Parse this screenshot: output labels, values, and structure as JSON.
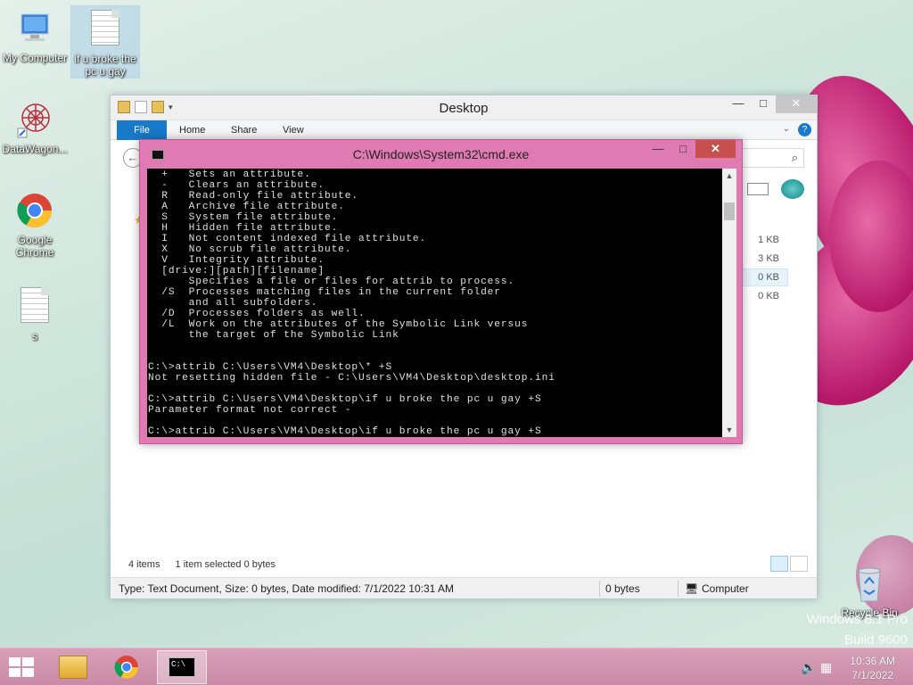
{
  "desktop": {
    "icons": [
      {
        "label": "My Computer"
      },
      {
        "label": "if u broke the pc u gay"
      },
      {
        "label": "DataWagon..."
      },
      {
        "label": "Google Chrome"
      },
      {
        "label": "s"
      },
      {
        "label": "Recycle Bin"
      }
    ],
    "watermark": {
      "line1": "Windows 8.1 Pro",
      "line2": "Build 9600"
    }
  },
  "explorer": {
    "title": "Desktop",
    "ribbon_tabs": {
      "file": "File",
      "home": "Home",
      "share": "Share",
      "view": "View"
    },
    "sizes": [
      "1 KB",
      "3 KB",
      "0 KB",
      "0 KB"
    ],
    "status": {
      "items": "4 items",
      "selected": "1 item selected  0 bytes"
    },
    "details": {
      "info": "Type: Text Document, Size: 0 bytes, Date modified: 7/1/2022 10:31 AM",
      "size": "0 bytes",
      "location": "Computer"
    }
  },
  "cmd": {
    "title": "C:\\Windows\\System32\\cmd.exe",
    "output": "  +   Sets an attribute.\n  -   Clears an attribute.\n  R   Read-only file attribute.\n  A   Archive file attribute.\n  S   System file attribute.\n  H   Hidden file attribute.\n  I   Not content indexed file attribute.\n  X   No scrub file attribute.\n  V   Integrity attribute.\n  [drive:][path][filename]\n      Specifies a file or files for attrib to process.\n  /S  Processes matching files in the current folder\n      and all subfolders.\n  /D  Processes folders as well.\n  /L  Work on the attributes of the Symbolic Link versus\n      the target of the Symbolic Link\n\n\nC:\\>attrib C:\\Users\\VM4\\Desktop\\* +S\nNot resetting hidden file - C:\\Users\\VM4\\Desktop\\desktop.ini\n\nC:\\>attrib C:\\Users\\VM4\\Desktop\\if u broke the pc u gay +S\nParameter format not correct -\n\nC:\\>attrib C:\\Users\\VM4\\Desktop\\if u broke the pc u gay +S"
  },
  "taskbar": {
    "clock_time": "10:36 AM",
    "clock_date": "7/1/2022",
    "accent": "#c98aa6"
  }
}
